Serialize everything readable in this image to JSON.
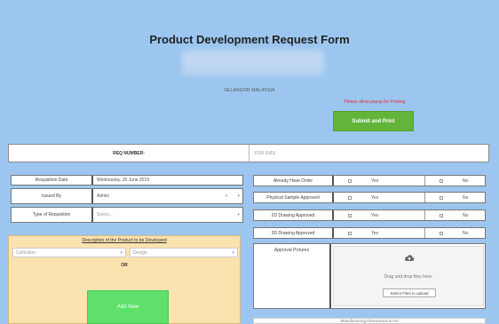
{
  "form": {
    "title": "Product Development Request Form",
    "location": "SELANGOR MALAYSIA",
    "notice": "Please allow popup for Printing",
    "submit_label": "Submit and Print"
  },
  "req": {
    "label": "REQ NUMBER:",
    "placeholder": "FOR EMS"
  },
  "left_fields": [
    {
      "label": "Requisition Date",
      "value": "Wednesday, 26 June 2019"
    },
    {
      "label": "Issued By",
      "value": "Admin"
    },
    {
      "label": "Type of Requisition",
      "value": "Select..."
    }
  ],
  "right_fields": [
    {
      "label": "Already Have Order",
      "yes": "Yes",
      "no": "No"
    },
    {
      "label": "Physical Sample Approved",
      "yes": "Yes",
      "no": "No"
    },
    {
      "label": "2D Drawing Approved",
      "yes": "Yes",
      "no": "No"
    },
    {
      "label": "3D Drawing Approved",
      "yes": "Yes",
      "no": "No"
    }
  ],
  "description": {
    "title": "Description of the Product to be Developed",
    "collection_placeholder": "Collection",
    "design_placeholder": "Design",
    "or_label": "OR",
    "add_new_label": "Add New"
  },
  "approval": {
    "label": "Approval Pictures",
    "drop_text": "Drag and drop files here.",
    "browse_label": "Select Files to upload"
  },
  "bottom_strip_text": "Manufacturing Dimensions & Ind"
}
